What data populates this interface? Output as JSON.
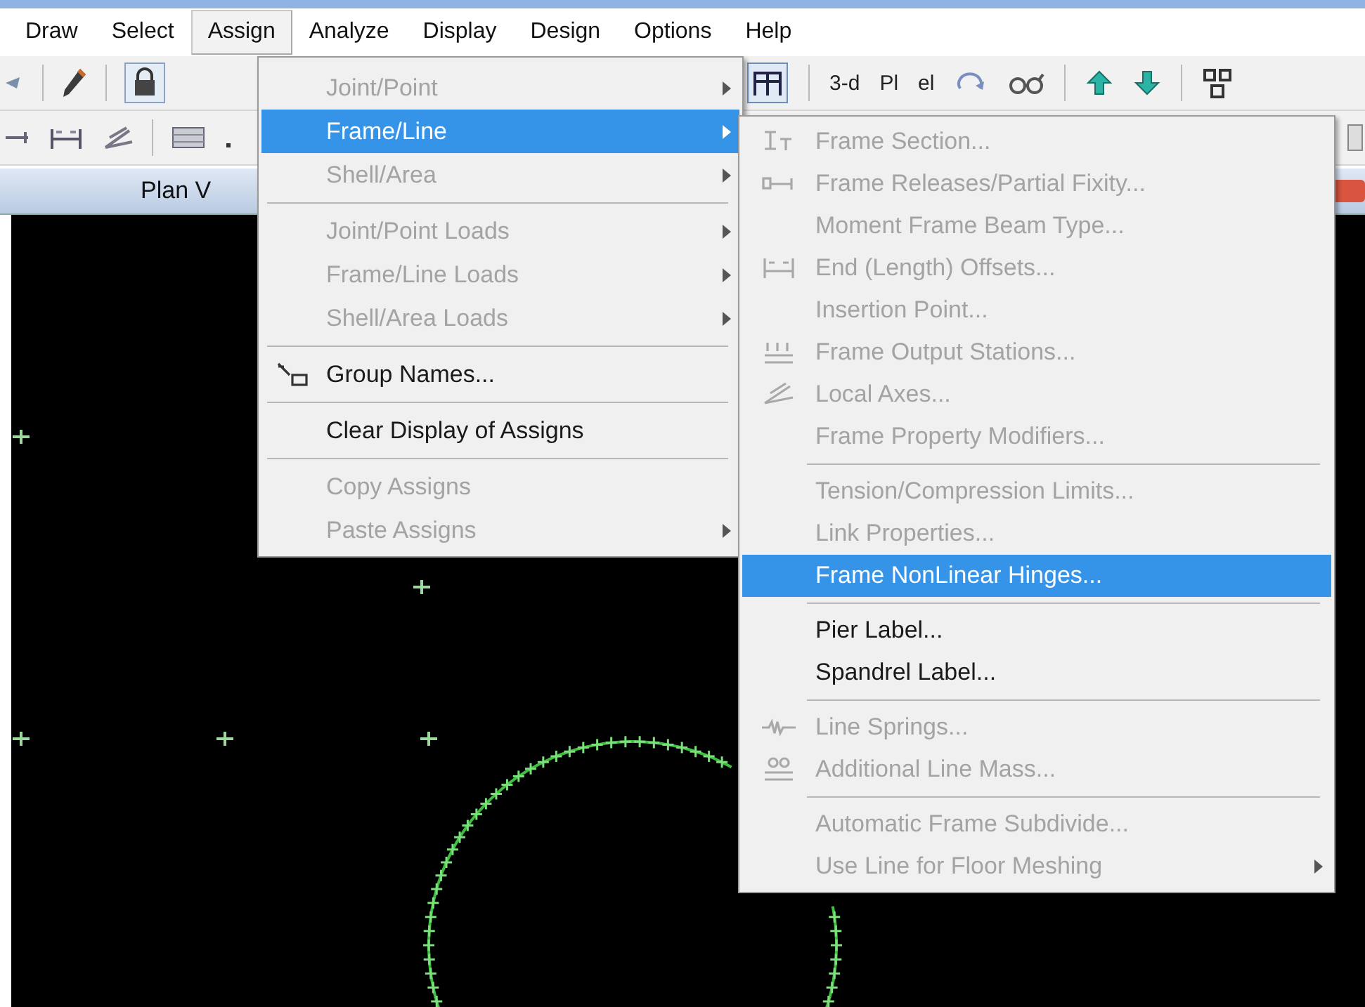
{
  "menu_bar": [
    {
      "label": "Draw",
      "selected": false
    },
    {
      "label": "Select",
      "selected": false
    },
    {
      "label": "Assign",
      "selected": true
    },
    {
      "label": "Analyze",
      "selected": false
    },
    {
      "label": "Display",
      "selected": false
    },
    {
      "label": "Design",
      "selected": false
    },
    {
      "label": "Options",
      "selected": false
    },
    {
      "label": "Help",
      "selected": false
    }
  ],
  "toolbar": [
    {
      "label": "3-d"
    },
    {
      "label": "Pl"
    },
    {
      "label": "el"
    }
  ],
  "view_title": "Plan V",
  "assign_menu": {
    "items": [
      {
        "kind": "item",
        "label": "Joint/Point",
        "disabled": true,
        "submenu": true,
        "selected": false
      },
      {
        "kind": "item",
        "label": "Frame/Line",
        "disabled": false,
        "submenu": true,
        "selected": true
      },
      {
        "kind": "item",
        "label": "Shell/Area",
        "disabled": true,
        "submenu": true,
        "selected": false
      },
      {
        "kind": "separator"
      },
      {
        "kind": "item",
        "label": "Joint/Point Loads",
        "disabled": true,
        "submenu": true,
        "selected": false
      },
      {
        "kind": "item",
        "label": "Frame/Line Loads",
        "disabled": true,
        "submenu": true,
        "selected": false
      },
      {
        "kind": "item",
        "label": "Shell/Area Loads",
        "disabled": true,
        "submenu": true,
        "selected": false
      },
      {
        "kind": "separator"
      },
      {
        "kind": "item",
        "label": "Group Names...",
        "disabled": false,
        "submenu": false,
        "selected": false
      },
      {
        "kind": "separator"
      },
      {
        "kind": "item",
        "label": "Clear Display of Assigns",
        "disabled": false,
        "submenu": false,
        "selected": false
      },
      {
        "kind": "separator"
      },
      {
        "kind": "item",
        "label": "Copy Assigns",
        "disabled": true,
        "submenu": false,
        "selected": false
      },
      {
        "kind": "item",
        "label": "Paste Assigns",
        "disabled": true,
        "submenu": true,
        "selected": false
      }
    ]
  },
  "frame_submenu": {
    "items": [
      {
        "kind": "item",
        "label": "Frame Section...",
        "disabled": true,
        "submenu": false,
        "selected": false
      },
      {
        "kind": "item",
        "label": "Frame Releases/Partial Fixity...",
        "disabled": true,
        "submenu": false,
        "selected": false
      },
      {
        "kind": "item",
        "label": "Moment Frame Beam Type...",
        "disabled": true,
        "submenu": false,
        "selected": false
      },
      {
        "kind": "item",
        "label": "End (Length) Offsets...",
        "disabled": true,
        "submenu": false,
        "selected": false
      },
      {
        "kind": "item",
        "label": "Insertion Point...",
        "disabled": true,
        "submenu": false,
        "selected": false
      },
      {
        "kind": "item",
        "label": "Frame Output Stations...",
        "disabled": true,
        "submenu": false,
        "selected": false
      },
      {
        "kind": "item",
        "label": "Local Axes...",
        "disabled": true,
        "submenu": false,
        "selected": false
      },
      {
        "kind": "item",
        "label": "Frame Property Modifiers...",
        "disabled": true,
        "submenu": false,
        "selected": false
      },
      {
        "kind": "separator"
      },
      {
        "kind": "item",
        "label": "Tension/Compression Limits...",
        "disabled": true,
        "submenu": false,
        "selected": false
      },
      {
        "kind": "item",
        "label": "Link Properties...",
        "disabled": true,
        "submenu": false,
        "selected": false
      },
      {
        "kind": "item",
        "label": "Frame NonLinear Hinges...",
        "disabled": false,
        "submenu": false,
        "selected": true
      },
      {
        "kind": "separator"
      },
      {
        "kind": "item",
        "label": "Pier Label...",
        "disabled": false,
        "submenu": false,
        "selected": false
      },
      {
        "kind": "item",
        "label": "Spandrel Label...",
        "disabled": false,
        "submenu": false,
        "selected": false
      },
      {
        "kind": "separator"
      },
      {
        "kind": "item",
        "label": "Line Springs...",
        "disabled": true,
        "submenu": false,
        "selected": false
      },
      {
        "kind": "item",
        "label": "Additional Line Mass...",
        "disabled": true,
        "submenu": false,
        "selected": false
      },
      {
        "kind": "separator"
      },
      {
        "kind": "item",
        "label": "Automatic Frame Subdivide...",
        "disabled": true,
        "submenu": false,
        "selected": false
      },
      {
        "kind": "item",
        "label": "Use Line for Floor Meshing",
        "disabled": true,
        "submenu": true,
        "selected": false
      }
    ]
  }
}
